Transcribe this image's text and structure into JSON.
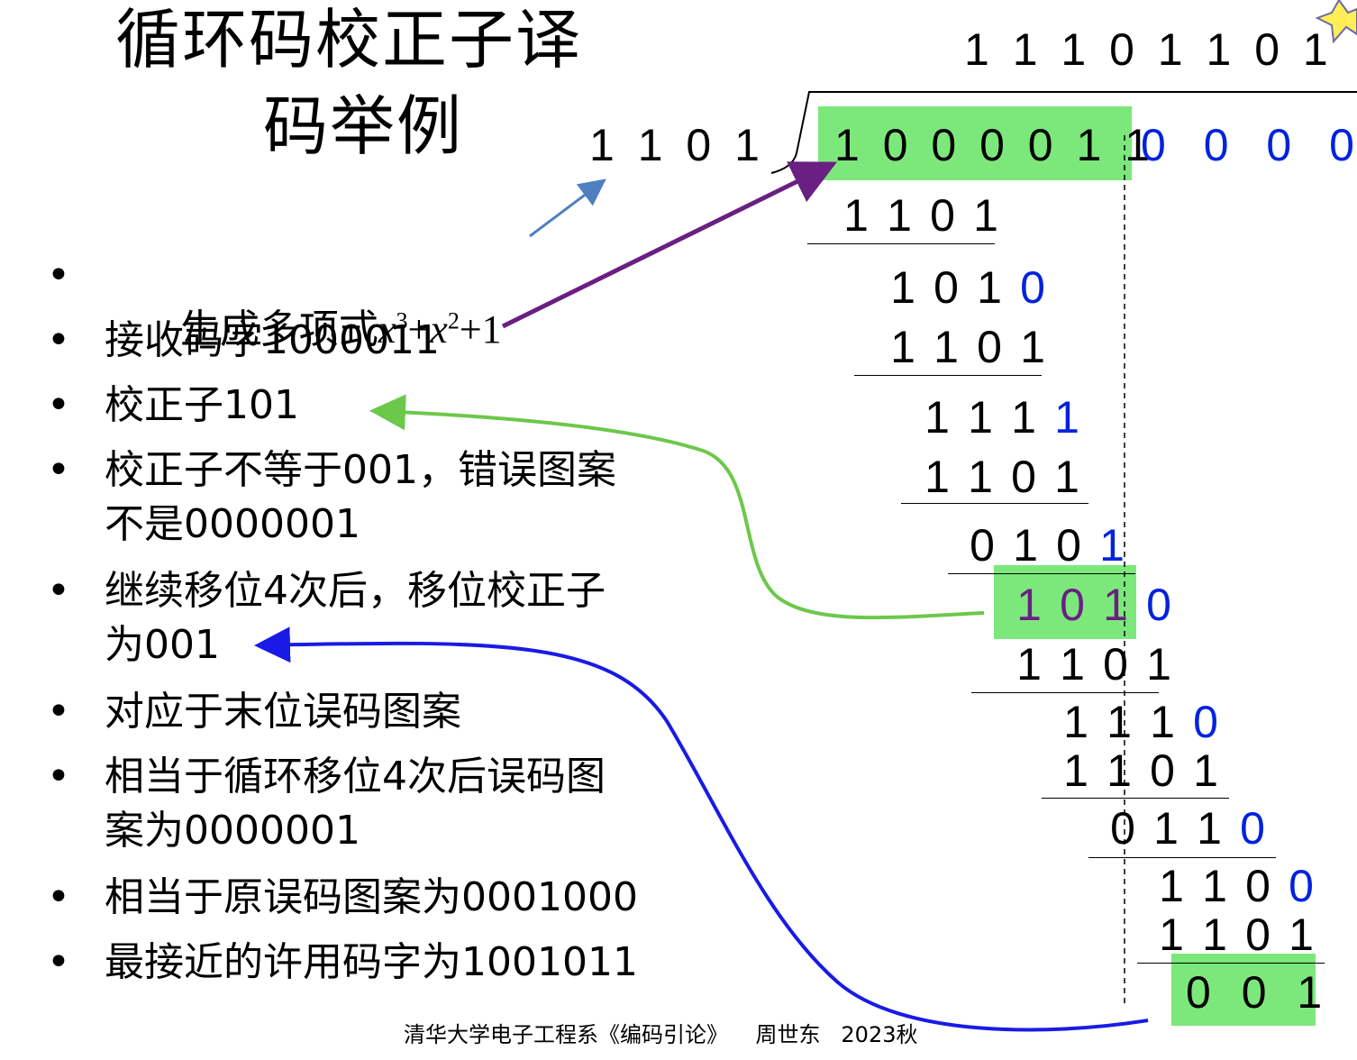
{
  "title": {
    "line1": "循环码校正子译",
    "line2": "码举例"
  },
  "bullets": [
    {
      "text": "生成多项式",
      "poly": true
    },
    {
      "text": "接收码字1000011"
    },
    {
      "text": "校正子101"
    },
    {
      "text": "校正子不等于001，错误图案\n不是0000001"
    },
    {
      "text": "继续移位4次后，移位校正子\n为001"
    },
    {
      "text": "对应于末位误码图案"
    },
    {
      "text": "相当于循环移位4次后误码图\n案为0000001"
    },
    {
      "text": "相当于原误码图案为0001000"
    },
    {
      "text": "最接近的许用码字为1001011"
    }
  ],
  "polynomial": {
    "x": "x",
    "exp3": "3",
    "plus": "+",
    "exp2": "2",
    "one": "+1"
  },
  "division": {
    "quotient": "1 1 1 0 1 1 0 1",
    "divisor": "1 1 0 1",
    "dividend_received": "1 0 0 0 0 1 1",
    "dividend_padding": "0 0 0 0",
    "steps": [
      {
        "digits": [
          "1",
          "1",
          "0",
          "1"
        ]
      },
      {
        "digits": [
          "1",
          "0",
          "1",
          "0"
        ],
        "last_blue": true
      },
      {
        "digits": [
          "1",
          "1",
          "0",
          "1"
        ]
      },
      {
        "digits": [
          "1",
          "1",
          "1",
          "1"
        ],
        "last_blue": true
      },
      {
        "digits": [
          "1",
          "1",
          "0",
          "1"
        ]
      },
      {
        "digits": [
          "0",
          "1",
          "0",
          "1"
        ],
        "last_blue": true
      },
      {
        "digits": [
          "1",
          "0",
          "1",
          "0"
        ],
        "syndrome": true
      },
      {
        "digits": [
          "1",
          "1",
          "0",
          "1"
        ]
      },
      {
        "digits": [
          "1",
          "1",
          "1",
          "0"
        ],
        "last_blue": true
      },
      {
        "digits": [
          "1",
          "1",
          "0",
          "1"
        ]
      },
      {
        "digits": [
          "0",
          "1",
          "1",
          "0"
        ],
        "last_blue": true
      },
      {
        "digits": [
          "1",
          "1",
          "0",
          "0"
        ],
        "last_blue": true
      },
      {
        "digits": [
          "1",
          "1",
          "0",
          "1"
        ]
      }
    ],
    "final_remainder": "0 0 1"
  },
  "footer": "清华大学电子工程系《编码引论》    周世东   2023秋",
  "colors": {
    "highlight": "#7ce87c",
    "blue_digit": "#0022dd",
    "purple_arrow": "#6a1f82",
    "green_arrow": "#6cc84a",
    "blue_arrow": "#1a1ae6",
    "steel_arrow": "#4f7fbf"
  }
}
